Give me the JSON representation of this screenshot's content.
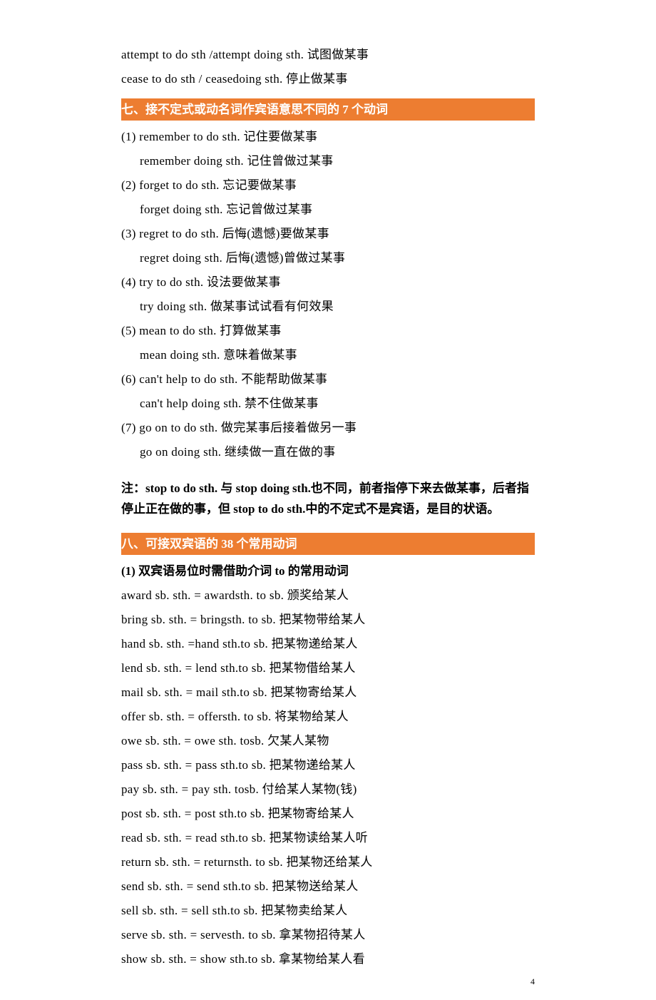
{
  "intro": {
    "l1": "attempt to do sth /attempt doing sth. 试图做某事",
    "l2": "cease to do sth / ceasedoing sth. 停止做某事"
  },
  "section7": {
    "title": " 七、接不定式或动名词作宾语意思不同的 7 个动词",
    "items": [
      "(1) remember to do sth. 记住要做某事",
      "remember doing sth. 记住曾做过某事",
      "(2) forget to do sth. 忘记要做某事",
      "forget doing sth. 忘记曾做过某事",
      "(3) regret to do sth. 后悔(遗憾)要做某事",
      "regret doing sth. 后悔(遗憾)曾做过某事",
      "(4) try to do sth. 设法要做某事",
      "try doing sth. 做某事试试看有何效果",
      "(5) mean to do sth. 打算做某事",
      "mean doing sth. 意味着做某事",
      "(6) can't help to do sth. 不能帮助做某事",
      "can't help doing sth. 禁不住做某事",
      "(7) go on to do sth. 做完某事后接着做另一事",
      "go on doing sth. 继续做一直在做的事"
    ]
  },
  "note7": "注：stop to do sth. 与 stop doing sth.也不同，前者指停下来去做某事，后者指停止正在做的事，但 stop to do sth.中的不定式不是宾语，是目的状语。",
  "section8": {
    "title": " 八、可接双宾语的 38 个常用动词",
    "subhead": "(1) 双宾语易位时需借助介词 to 的常用动词",
    "items": [
      "award sb. sth. = awardsth. to sb. 颁奖给某人",
      "bring sb. sth. = bringsth. to sb. 把某物带给某人",
      "hand sb. sth. =hand sth.to sb. 把某物递给某人",
      "lend sb. sth. = lend sth.to sb. 把某物借给某人",
      "mail sb. sth. = mail sth.to sb. 把某物寄给某人",
      "offer sb. sth. = offersth. to sb. 将某物给某人",
      "owe sb. sth. = owe sth. tosb. 欠某人某物",
      "pass sb. sth. = pass sth.to sb. 把某物递给某人",
      "pay sb. sth. = pay sth. tosb. 付给某人某物(钱)",
      "post sb. sth. = post sth.to sb. 把某物寄给某人",
      "read sb. sth. = read sth.to sb. 把某物读给某人听",
      "return sb. sth. = returnsth. to sb. 把某物还给某人",
      "send sb. sth. = send sth.to sb. 把某物送给某人",
      "sell sb. sth. = sell sth.to sb. 把某物卖给某人",
      "serve sb. sth. = servesth. to sb. 拿某物招待某人",
      "show sb. sth. = show sth.to sb. 拿某物给某人看"
    ]
  },
  "page": "4"
}
